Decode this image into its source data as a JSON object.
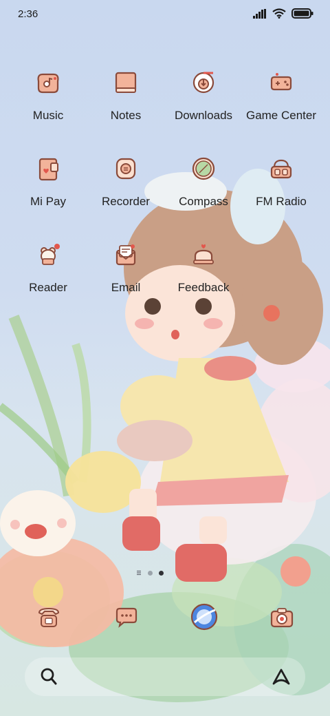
{
  "status_bar": {
    "time": "2:36"
  },
  "apps": [
    {
      "label": "Music",
      "icon": "music-icon"
    },
    {
      "label": "Notes",
      "icon": "notes-icon"
    },
    {
      "label": "Downloads",
      "icon": "downloads-icon"
    },
    {
      "label": "Game Center",
      "icon": "gamepad-icon"
    },
    {
      "label": "Mi Pay",
      "icon": "wallet-icon"
    },
    {
      "label": "Recorder",
      "icon": "recorder-icon"
    },
    {
      "label": "Compass",
      "icon": "compass-icon"
    },
    {
      "label": "FM Radio",
      "icon": "radio-icon"
    },
    {
      "label": "Reader",
      "icon": "reader-icon"
    },
    {
      "label": "Email",
      "icon": "envelope-icon"
    },
    {
      "label": "Feedback",
      "icon": "feedback-icon"
    }
  ],
  "dock": [
    {
      "name": "phone",
      "icon": "phone-icon"
    },
    {
      "name": "messages",
      "icon": "message-icon"
    },
    {
      "name": "browser",
      "icon": "browser-icon"
    },
    {
      "name": "camera",
      "icon": "camera-icon"
    }
  ],
  "page_indicator": {
    "pages": 2,
    "current": 2
  },
  "colors": {
    "icon_stroke": "#8a4a3a",
    "icon_fill": "#f2b39a",
    "accent": "#e2574c"
  }
}
